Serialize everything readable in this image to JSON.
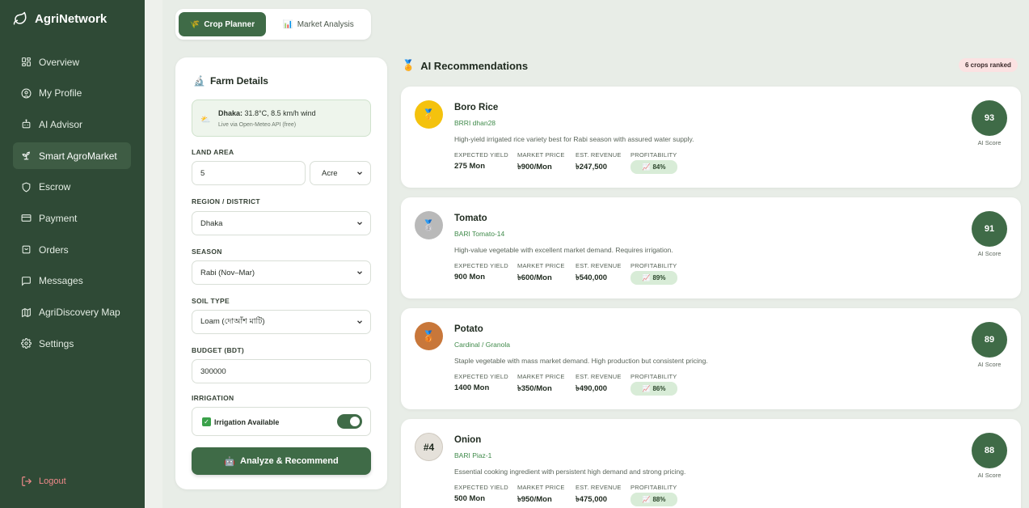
{
  "app": {
    "name": "AgriNetwork"
  },
  "sidebar": {
    "items": [
      {
        "label": "Overview",
        "icon": "grid-icon"
      },
      {
        "label": "My Profile",
        "icon": "user-circle-icon"
      },
      {
        "label": "AI Advisor",
        "icon": "robot-icon"
      },
      {
        "label": "Smart AgroMarket",
        "icon": "sprout-icon",
        "active": true
      },
      {
        "label": "Escrow",
        "icon": "shield-icon"
      },
      {
        "label": "Payment",
        "icon": "credit-card-icon"
      },
      {
        "label": "Orders",
        "icon": "package-icon"
      },
      {
        "label": "Messages",
        "icon": "chat-icon"
      },
      {
        "label": "AgriDiscovery Map",
        "icon": "map-icon"
      },
      {
        "label": "Settings",
        "icon": "gear-icon"
      }
    ],
    "logout": "Logout"
  },
  "tabs": {
    "crop_planner": "Crop Planner",
    "market_analysis": "Market Analysis"
  },
  "form": {
    "title": "Farm Details",
    "weather": {
      "place": "Dhaka:",
      "text": "31.8°C, 8.5 km/h wind",
      "source": "Live via Open-Meteo API (free)"
    },
    "land_area_label": "LAND AREA",
    "land_area_value": "5",
    "land_unit": "Acre",
    "region_label": "REGION / DISTRICT",
    "region_value": "Dhaka",
    "season_label": "SEASON",
    "season_value": "Rabi (Nov–Mar)",
    "soil_label": "SOIL TYPE",
    "soil_value": "Loam (দোআঁশ মাটি)",
    "budget_label": "BUDGET (BDT)",
    "budget_value": "300000",
    "irrigation_label": "IRRIGATION",
    "irrigation_text": "Irrigation Available",
    "irrigation_on": true,
    "analyze_button": "Analyze & Recommend"
  },
  "recommendations": {
    "title": "AI Recommendations",
    "ranked": "6 crops ranked",
    "headers": {
      "yield": "EXPECTED YIELD",
      "price": "MARKET PRICE",
      "revenue": "EST. REVENUE",
      "profitability": "PROFITABILITY"
    },
    "score_label": "AI Score",
    "crops": [
      {
        "name": "Boro Rice",
        "variety": "BRRI dhan28",
        "desc": "High-yield irrigated rice variety best for Rabi season with assured water supply.",
        "yield": "275 Mon",
        "price": "৳900/Mon",
        "revenue": "৳247,500",
        "profit": "84%",
        "score": "93",
        "medal": "🥇",
        "medal_color": "#f4c20d"
      },
      {
        "name": "Tomato",
        "variety": "BARI Tomato-14",
        "desc": "High-value vegetable with excellent market demand. Requires irrigation.",
        "yield": "900 Mon",
        "price": "৳600/Mon",
        "revenue": "৳540,000",
        "profit": "89%",
        "score": "91",
        "medal": "🥈",
        "medal_color": "#b9b9b9"
      },
      {
        "name": "Potato",
        "variety": "Cardinal / Granola",
        "desc": "Staple vegetable with mass market demand. High production but consistent pricing.",
        "yield": "1400 Mon",
        "price": "৳350/Mon",
        "revenue": "৳490,000",
        "profit": "86%",
        "score": "89",
        "medal": "🥉",
        "medal_color": "#c8773a"
      },
      {
        "name": "Onion",
        "variety": "BARI Piaz-1",
        "desc": "Essential cooking ingredient with persistent high demand and strong pricing.",
        "yield": "500 Mon",
        "price": "৳950/Mon",
        "revenue": "৳475,000",
        "profit": "88%",
        "score": "88",
        "medal": "#4",
        "medal_color": "#e5e1da"
      }
    ]
  }
}
